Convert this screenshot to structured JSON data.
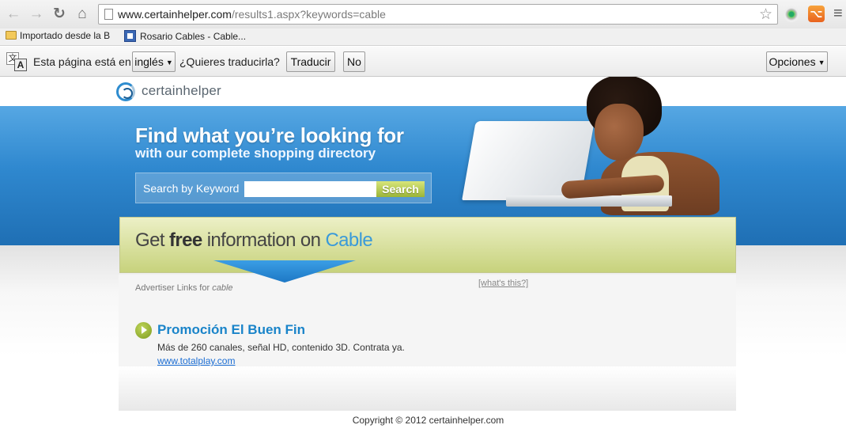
{
  "browser": {
    "url_host": "www.certainhelper.com",
    "url_path": "/results1.aspx?keywords=cable",
    "bookmarks": [
      "Importado desde la B",
      "Rosario Cables - Cable..."
    ],
    "icons": {
      "back": "arrow-left-icon",
      "forward": "arrow-right-icon",
      "reload": "reload-icon",
      "home": "home-icon",
      "star": "star-icon",
      "extension": "eye-icon",
      "feed": "rss-icon",
      "menu": "menu-icon"
    }
  },
  "translate_bar": {
    "prefix": "Esta página está en",
    "language": "inglés",
    "question": "¿Quieres traducirla?",
    "translate": "Traducir",
    "no": "No",
    "options": "Opciones"
  },
  "site": {
    "logo_text": "certainhelper",
    "hero_title": "Find what you’re looking for",
    "hero_subtitle": "with our complete shopping directory",
    "search_label": "Search by Keyword",
    "search_value": "",
    "search_button": "Search",
    "banner_get": "Get",
    "banner_free": "free",
    "banner_info": "information on",
    "banner_keyword": "Cable",
    "advertiser_prefix": "Advertiser Links for",
    "advertiser_keyword": "cable",
    "whats_this": "[what's this?]",
    "ad": {
      "title": "Promoción El Buen Fin",
      "description": "Más de 260 canales, señal HD, contenido 3D. Contrata ya.",
      "url": "www.totalplay.com"
    },
    "copyright": "Copyright © 2012 certainhelper.com"
  },
  "colors": {
    "hero_blue": "#2f88cf",
    "banner_green": "#c7d27c",
    "link_blue": "#1a84c9",
    "keyword_blue": "#3a9ad9"
  }
}
